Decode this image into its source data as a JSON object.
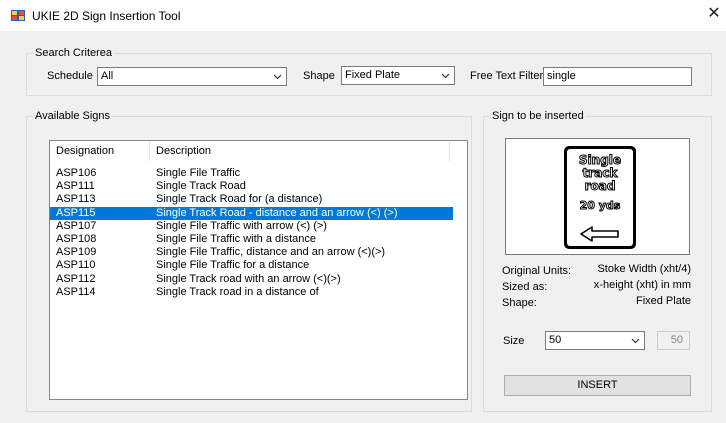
{
  "window": {
    "title": "UKIE 2D Sign Insertion Tool",
    "close_glyph": "✕"
  },
  "search": {
    "group_title": "Search Criterea",
    "schedule_label": "Schedule",
    "schedule_value": "All",
    "shape_label": "Shape",
    "shape_value": "Fixed Plate",
    "filter_label": "Free Text Filter",
    "filter_value": "single"
  },
  "available": {
    "group_title": "Available Signs",
    "columns": [
      "Designation",
      "Description"
    ],
    "rows": [
      {
        "designation": "ASP106",
        "description": "Single File Traffic",
        "selected": false
      },
      {
        "designation": "ASP111",
        "description": "Single Track Road",
        "selected": false
      },
      {
        "designation": "ASP113",
        "description": "Single Track Road for (a distance)",
        "selected": false
      },
      {
        "designation": "ASP115",
        "description": "Single Track Road - distance and an arrow (<) (>)",
        "selected": true
      },
      {
        "designation": "ASP107",
        "description": "Single File Traffic with arrow (<) (>)",
        "selected": false
      },
      {
        "designation": "ASP108",
        "description": "Single File Traffic with a distance",
        "selected": false
      },
      {
        "designation": "ASP109",
        "description": "Single File Traffic, distance and an arrow (<)(>)",
        "selected": false
      },
      {
        "designation": "ASP110",
        "description": "Single File Traffic for a distance",
        "selected": false
      },
      {
        "designation": "ASP112",
        "description": "Single Track road with an arrow (<)(>)",
        "selected": false
      },
      {
        "designation": "ASP114",
        "description": "Single Track road in a distance of",
        "selected": false
      }
    ]
  },
  "insert_panel": {
    "group_title": "Sign to be inserted",
    "sign_lines": [
      "Single",
      "track",
      "road",
      "20 yds"
    ],
    "original_units_label": "Original Units:",
    "original_units_value": "Stoke Width (xht/4)",
    "sized_as_label": "Sized as:",
    "sized_as_value": "x-height (xht) in mm",
    "shape_label": "Shape:",
    "shape_value": "Fixed Plate",
    "size_label": "Size",
    "size_value": "50",
    "size_readout": "50",
    "insert_label": "INSERT"
  }
}
